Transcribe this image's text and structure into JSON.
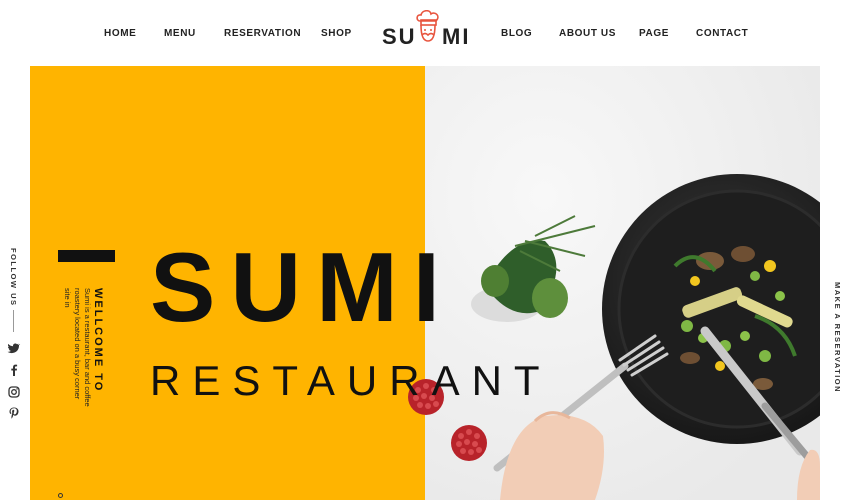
{
  "nav": {
    "home": "HOME",
    "menu": "MENU",
    "reservation": "RESERVATION",
    "shop": "SHOP",
    "blog": "BLOG",
    "about": "ABOUT US",
    "page": "PAGE",
    "contact": "CONTACT"
  },
  "logo": {
    "left": "SU",
    "right": "MI"
  },
  "hero": {
    "title": "SUMI",
    "subtitle": "RESTAURANT",
    "welcome": "WELLCOME TO",
    "intro": "Sumi is a restaurant, bar and coffee roastery located on a busy corner site in"
  },
  "sidebar_left": {
    "follow": "FOLLOW US",
    "icons": [
      "twitter-icon",
      "facebook-icon",
      "instagram-icon",
      "pinterest-icon"
    ]
  },
  "sidebar_right": {
    "reservation": "MAKE A RESERVATION"
  },
  "colors": {
    "accent": "#ffb400",
    "text": "#111111",
    "logo_accent": "#e8553f"
  }
}
